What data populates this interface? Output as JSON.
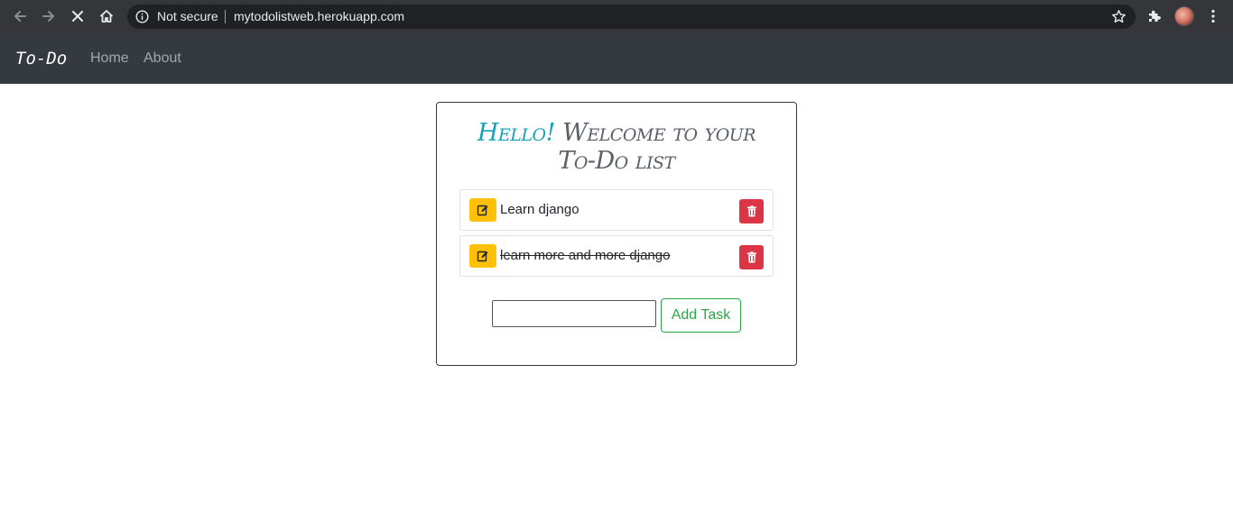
{
  "browser": {
    "security_label": "Not secure",
    "url": "mytodolistweb.herokuapp.com"
  },
  "navbar": {
    "brand": "To-Do",
    "links": [
      "Home",
      "About"
    ]
  },
  "card": {
    "heading_hello": "Hello!",
    "heading_rest_line1": "Welcome to your",
    "heading_line2": "To-Do list"
  },
  "tasks": [
    {
      "text": "Learn django",
      "completed": false
    },
    {
      "text": "learn more and more django",
      "completed": true
    }
  ],
  "add_task": {
    "input_value": "",
    "button_label": "Add Task"
  },
  "colors": {
    "edit": "#ffc107",
    "delete": "#dc3545",
    "add": "#28a745",
    "hello": "#17a2b8",
    "navbar": "#343a40"
  }
}
